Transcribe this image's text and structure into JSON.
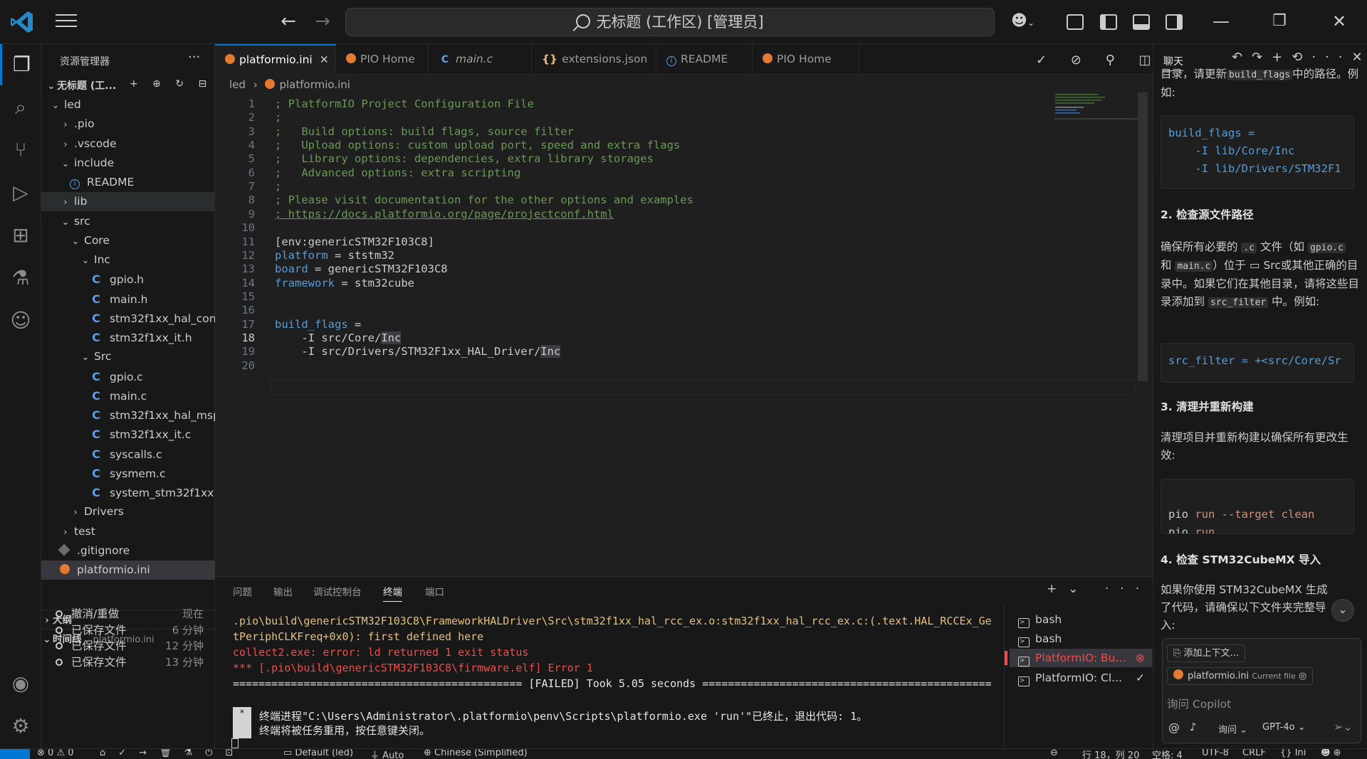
{
  "window": {
    "title": "无标题 (工作区) [管理员]"
  },
  "sidebar": {
    "header": "资源管理器",
    "workspace": "无标题 (工...",
    "tree": [
      {
        "label": "led",
        "depth": 0,
        "kind": "folder-open"
      },
      {
        "label": ".pio",
        "depth": 1,
        "kind": "folder"
      },
      {
        "label": ".vscode",
        "depth": 1,
        "kind": "folder"
      },
      {
        "label": "include",
        "depth": 1,
        "kind": "folder-open"
      },
      {
        "label": "README",
        "depth": 2,
        "kind": "info"
      },
      {
        "label": "lib",
        "depth": 1,
        "kind": "folder"
      },
      {
        "label": "src",
        "depth": 1,
        "kind": "folder-open"
      },
      {
        "label": "Core",
        "depth": 2,
        "kind": "folder-open"
      },
      {
        "label": "Inc",
        "depth": 3,
        "kind": "folder-open"
      },
      {
        "label": "gpio.h",
        "depth": 4,
        "kind": "c"
      },
      {
        "label": "main.h",
        "depth": 4,
        "kind": "c"
      },
      {
        "label": "stm32f1xx_hal_conf.h",
        "depth": 4,
        "kind": "c"
      },
      {
        "label": "stm32f1xx_it.h",
        "depth": 4,
        "kind": "c"
      },
      {
        "label": "Src",
        "depth": 3,
        "kind": "folder-open"
      },
      {
        "label": "gpio.c",
        "depth": 4,
        "kind": "c"
      },
      {
        "label": "main.c",
        "depth": 4,
        "kind": "c"
      },
      {
        "label": "stm32f1xx_hal_msp.c",
        "depth": 4,
        "kind": "c"
      },
      {
        "label": "stm32f1xx_it.c",
        "depth": 4,
        "kind": "c"
      },
      {
        "label": "syscalls.c",
        "depth": 4,
        "kind": "c"
      },
      {
        "label": "sysmem.c",
        "depth": 4,
        "kind": "c"
      },
      {
        "label": "system_stm32f1xx.c",
        "depth": 4,
        "kind": "c"
      },
      {
        "label": "Drivers",
        "depth": 2,
        "kind": "folder"
      },
      {
        "label": "test",
        "depth": 1,
        "kind": "folder"
      },
      {
        "label": ".gitignore",
        "depth": 1,
        "kind": "git"
      },
      {
        "label": "platformio.ini",
        "depth": 1,
        "kind": "pio"
      }
    ],
    "outline_label": "大纲",
    "timeline_label": "时间线",
    "timeline_file": "platformio.ini",
    "timeline": [
      {
        "label": "撤消/重做",
        "time": "现在"
      },
      {
        "label": "已保存文件",
        "time": "6 分钟"
      },
      {
        "label": "已保存文件",
        "time": "12 分钟"
      },
      {
        "label": "已保存文件",
        "time": "13 分钟"
      }
    ]
  },
  "tabs": [
    {
      "label": "platformio.ini",
      "icon": "pio",
      "active": true
    },
    {
      "label": "PIO Home",
      "icon": "pio"
    },
    {
      "label": "main.c",
      "icon": "c"
    },
    {
      "label": "extensions.json",
      "icon": "json"
    },
    {
      "label": "README",
      "icon": "info"
    },
    {
      "label": "PIO Home",
      "icon": "pio"
    }
  ],
  "breadcrumb": {
    "folder": "led",
    "file": "platformio.ini"
  },
  "editor": {
    "current_line": 18,
    "lines": [
      "; PlatformIO Project Configuration File",
      ";",
      ";   Build options: build flags, source filter",
      ";   Upload options: custom upload port, speed and extra flags",
      ";   Library options: dependencies, extra library storages",
      ";   Advanced options: extra scripting",
      ";",
      "; Please visit documentation for the other options and examples",
      "; https://docs.platformio.org/page/projectconf.html",
      "",
      "[env:genericSTM32F103C8]",
      "platform = ststm32",
      "board = genericSTM32F103C8",
      "framework = stm32cube",
      "",
      "",
      "build_flags =",
      "    -I src/Core/Inc",
      "    -I src/Drivers/STM32F1xx_HAL_Driver/Inc",
      ""
    ]
  },
  "panel": {
    "tabs": [
      "问题",
      "输出",
      "调试控制台",
      "终端",
      "端口"
    ],
    "active_tab": "终端",
    "terminal_lines": [
      {
        "text": ".pio\\build\\genericSTM32F103C8\\FrameworkHALDriver\\Src\\stm32f1xx_hal_rcc_ex.o:stm32f1xx_hal_rcc_ex.c:(.text.HAL_RCCEx_Ge",
        "color": "yellow"
      },
      {
        "text": "tPeriphCLKFreq+0x0): first defined here",
        "color": "yellow"
      },
      {
        "text": "collect2.exe: error: ld returned 1 exit status",
        "color": "red"
      },
      {
        "text": "*** [.pio\\build\\genericSTM32F103C8\\firmware.elf] Error 1",
        "color": "red"
      },
      {
        "text": "============================================= [FAILED] Took 5.05 seconds =============================================",
        "color": "white"
      },
      {
        "text": "",
        "color": "white"
      },
      {
        "text": " 终端进程\"C:\\Users\\Administrator\\.platformio\\penv\\Scripts\\platformio.exe 'run'\"已终止，退出代码: 1。",
        "color": "white"
      },
      {
        "text": " 终端将被任务重用，按任意键关闭。",
        "color": "white"
      }
    ],
    "terminals": [
      {
        "label": "bash"
      },
      {
        "label": "bash"
      },
      {
        "label": "PlatformIO: Bu...",
        "selected": true,
        "status": "error"
      },
      {
        "label": "PlatformIO: Cl...",
        "status": "ok"
      }
    ]
  },
  "chat": {
    "title": "聊天",
    "intro_part": "目录，请更新",
    "intro_code": "build_flags",
    "intro_tail": "中的路径。例如:",
    "block1": "build_flags =\n    -I lib/Core/Inc\n    -I lib/Drivers/STM32F1",
    "h2": "2. 检查源文件路径",
    "p2a": "确保所有必要的",
    "p2_code1": ".c",
    "p2b": "文件（如",
    "p2_code2": "gpio.c",
    "p2c": "和",
    "p2_code3": "main.c",
    "p2d": "）位于",
    "p2_src": "Src",
    "p2e": "或其他正确的目录中。如果它们在其他目录，请将这些目录添加到",
    "p2_code4": "src_filter",
    "p2f": "中。例如:",
    "block2": "src_filter = +<src/Core/Sr",
    "h3": "3. 清理并重新构建",
    "p3": "清理项目并重新构建以确保所有更改生效:",
    "block3_l1_cmd": "pio",
    "block3_l1_arg": "run --target clean",
    "block3_l2_cmd": "pio",
    "block3_l2_arg": "run",
    "h4": "4. 检查 STM32CubeMX 导入",
    "p4": "如果你使用 STM32CubeMX 生成了代码，请确保以下文件夹完整导入:",
    "add_context": "添加上下文...",
    "current_file": "platformio.ini",
    "current_file_tag": "Current file",
    "input_placeholder": "询问 Copilot",
    "mode": "询问",
    "model": "GPT-4o"
  },
  "statusbar": {
    "errors": "0",
    "warnings": "0",
    "env": "Default (led)",
    "auto": "Auto",
    "lang_pack": "Chinese (Simplified)",
    "position": "行 18，列 20",
    "spaces": "空格: 4",
    "encoding": "UTF-8",
    "eol": "CRLF",
    "language": "Ini"
  },
  "colors": {
    "accent": "#0078d4",
    "comment": "#6a9955",
    "keyword": "#569cd6",
    "error": "#f14c4c",
    "warning": "#e5c07b"
  }
}
